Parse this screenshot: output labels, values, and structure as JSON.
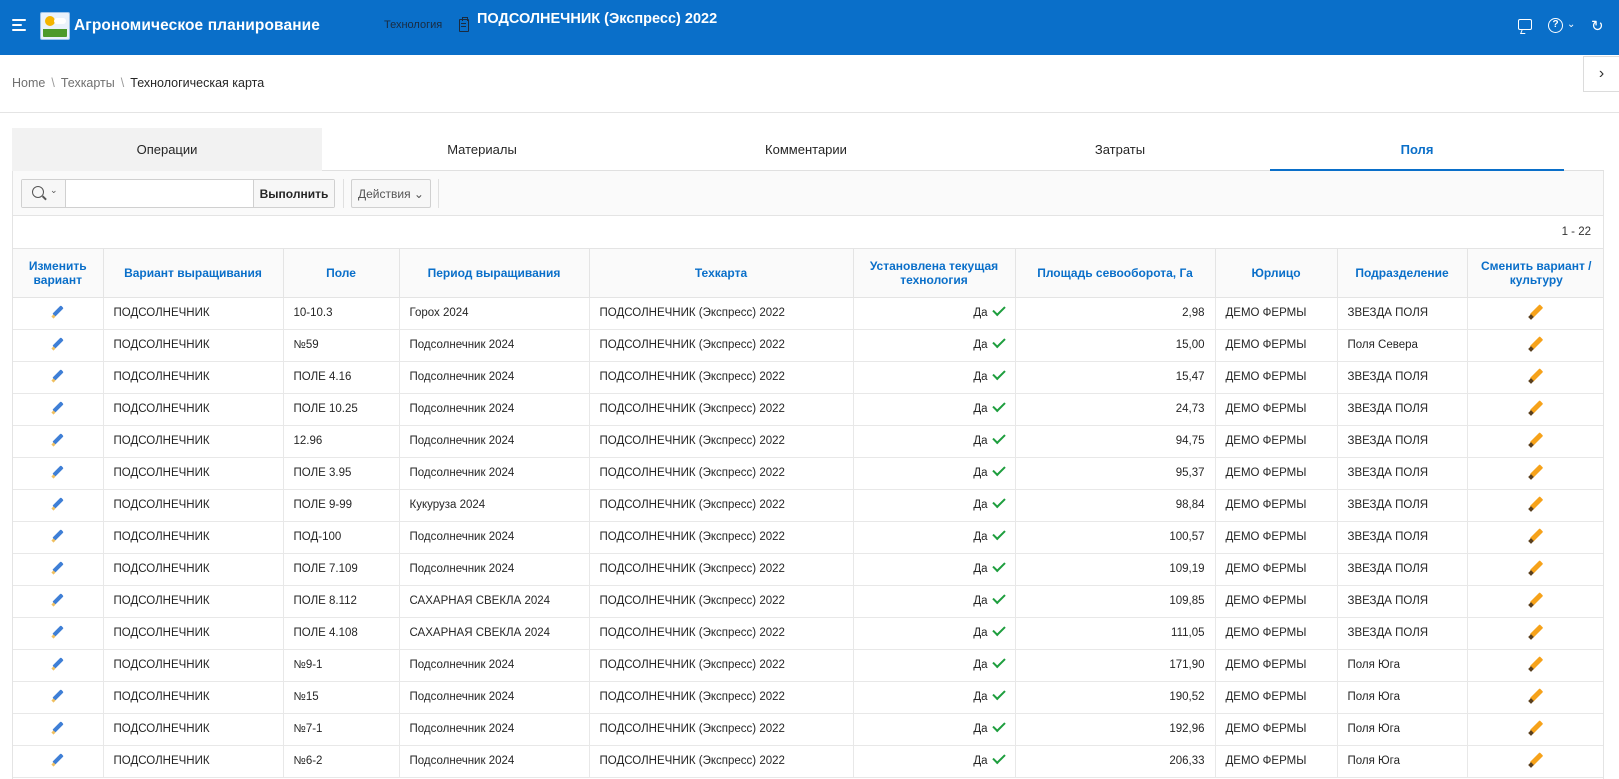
{
  "header": {
    "app_title": "Агрономическое планирование",
    "tech_label": "Технология",
    "tech_title": "ПОДСОЛНЕЧНИК (Экспресс) 2022"
  },
  "breadcrumb": {
    "home": "Home",
    "techcards": "Техкарты",
    "current": "Технологическая карта"
  },
  "tabs": [
    "Операции",
    "Материалы",
    "Комментарии",
    "Затраты",
    "Поля"
  ],
  "toolbar": {
    "search_value": "",
    "run_label": "Выполнить",
    "actions_label": "Действия"
  },
  "pager": "1 - 22",
  "columns": [
    "Изменить вариант",
    "Вариант выращивания",
    "Поле",
    "Период выращивания",
    "Техкарта",
    "Установлена текущая технология",
    "Площадь севооборота, Га",
    "Юрлицо",
    "Подразделение",
    "Сменить вариант /культуру"
  ],
  "rows": [
    {
      "variant": "ПОДСОЛНЕЧНИК",
      "field": "10-10.3",
      "period": "Горох 2024",
      "card": "ПОДСОЛНЕЧНИК (Экспресс) 2022",
      "current": "Да",
      "area": "2,98",
      "entity": "ДЕМО ФЕРМЫ",
      "division": "ЗВЕЗДА ПОЛЯ"
    },
    {
      "variant": "ПОДСОЛНЕЧНИК",
      "field": "№59",
      "period": "Подсолнечник 2024",
      "card": "ПОДСОЛНЕЧНИК (Экспресс) 2022",
      "current": "Да",
      "area": "15,00",
      "entity": "ДЕМО ФЕРМЫ",
      "division": "Поля Севера"
    },
    {
      "variant": "ПОДСОЛНЕЧНИК",
      "field": "ПОЛЕ 4.16",
      "period": "Подсолнечник 2024",
      "card": "ПОДСОЛНЕЧНИК (Экспресс) 2022",
      "current": "Да",
      "area": "15,47",
      "entity": "ДЕМО ФЕРМЫ",
      "division": "ЗВЕЗДА ПОЛЯ"
    },
    {
      "variant": "ПОДСОЛНЕЧНИК",
      "field": "ПОЛЕ 10.25",
      "period": "Подсолнечник 2024",
      "card": "ПОДСОЛНЕЧНИК (Экспресс) 2022",
      "current": "Да",
      "area": "24,73",
      "entity": "ДЕМО ФЕРМЫ",
      "division": "ЗВЕЗДА ПОЛЯ"
    },
    {
      "variant": "ПОДСОЛНЕЧНИК",
      "field": "12.96",
      "period": "Подсолнечник 2024",
      "card": "ПОДСОЛНЕЧНИК (Экспресс) 2022",
      "current": "Да",
      "area": "94,75",
      "entity": "ДЕМО ФЕРМЫ",
      "division": "ЗВЕЗДА ПОЛЯ"
    },
    {
      "variant": "ПОДСОЛНЕЧНИК",
      "field": "ПОЛЕ 3.95",
      "period": "Подсолнечник 2024",
      "card": "ПОДСОЛНЕЧНИК (Экспресс) 2022",
      "current": "Да",
      "area": "95,37",
      "entity": "ДЕМО ФЕРМЫ",
      "division": "ЗВЕЗДА ПОЛЯ"
    },
    {
      "variant": "ПОДСОЛНЕЧНИК",
      "field": "ПОЛЕ 9-99",
      "period": "Кукуруза 2024",
      "card": "ПОДСОЛНЕЧНИК (Экспресс) 2022",
      "current": "Да",
      "area": "98,84",
      "entity": "ДЕМО ФЕРМЫ",
      "division": "ЗВЕЗДА ПОЛЯ"
    },
    {
      "variant": "ПОДСОЛНЕЧНИК",
      "field": "ПОД-100",
      "period": "Подсолнечник 2024",
      "card": "ПОДСОЛНЕЧНИК (Экспресс) 2022",
      "current": "Да",
      "area": "100,57",
      "entity": "ДЕМО ФЕРМЫ",
      "division": "ЗВЕЗДА ПОЛЯ"
    },
    {
      "variant": "ПОДСОЛНЕЧНИК",
      "field": "ПОЛЕ 7.109",
      "period": "Подсолнечник 2024",
      "card": "ПОДСОЛНЕЧНИК (Экспресс) 2022",
      "current": "Да",
      "area": "109,19",
      "entity": "ДЕМО ФЕРМЫ",
      "division": "ЗВЕЗДА ПОЛЯ"
    },
    {
      "variant": "ПОДСОЛНЕЧНИК",
      "field": "ПОЛЕ 8.112",
      "period": "САХАРНАЯ СВЕКЛА 2024",
      "card": "ПОДСОЛНЕЧНИК (Экспресс) 2022",
      "current": "Да",
      "area": "109,85",
      "entity": "ДЕМО ФЕРМЫ",
      "division": "ЗВЕЗДА ПОЛЯ"
    },
    {
      "variant": "ПОДСОЛНЕЧНИК",
      "field": "ПОЛЕ 4.108",
      "period": "САХАРНАЯ СВЕКЛА 2024",
      "card": "ПОДСОЛНЕЧНИК (Экспресс) 2022",
      "current": "Да",
      "area": "111,05",
      "entity": "ДЕМО ФЕРМЫ",
      "division": "ЗВЕЗДА ПОЛЯ"
    },
    {
      "variant": "ПОДСОЛНЕЧНИК",
      "field": "№9-1",
      "period": "Подсолнечник 2024",
      "card": "ПОДСОЛНЕЧНИК (Экспресс) 2022",
      "current": "Да",
      "area": "171,90",
      "entity": "ДЕМО ФЕРМЫ",
      "division": "Поля Юга"
    },
    {
      "variant": "ПОДСОЛНЕЧНИК",
      "field": "№15",
      "period": "Подсолнечник 2024",
      "card": "ПОДСОЛНЕЧНИК (Экспресс) 2022",
      "current": "Да",
      "area": "190,52",
      "entity": "ДЕМО ФЕРМЫ",
      "division": "Поля Юга"
    },
    {
      "variant": "ПОДСОЛНЕЧНИК",
      "field": "№7-1",
      "period": "Подсолнечник 2024",
      "card": "ПОДСОЛНЕЧНИК (Экспресс) 2022",
      "current": "Да",
      "area": "192,96",
      "entity": "ДЕМО ФЕРМЫ",
      "division": "Поля Юга"
    },
    {
      "variant": "ПОДСОЛНЕЧНИК",
      "field": "№6-2",
      "period": "Подсолнечник 2024",
      "card": "ПОДСОЛНЕЧНИК (Экспресс) 2022",
      "current": "Да",
      "area": "206,33",
      "entity": "ДЕМО ФЕРМЫ",
      "division": "Поля Юга"
    }
  ]
}
